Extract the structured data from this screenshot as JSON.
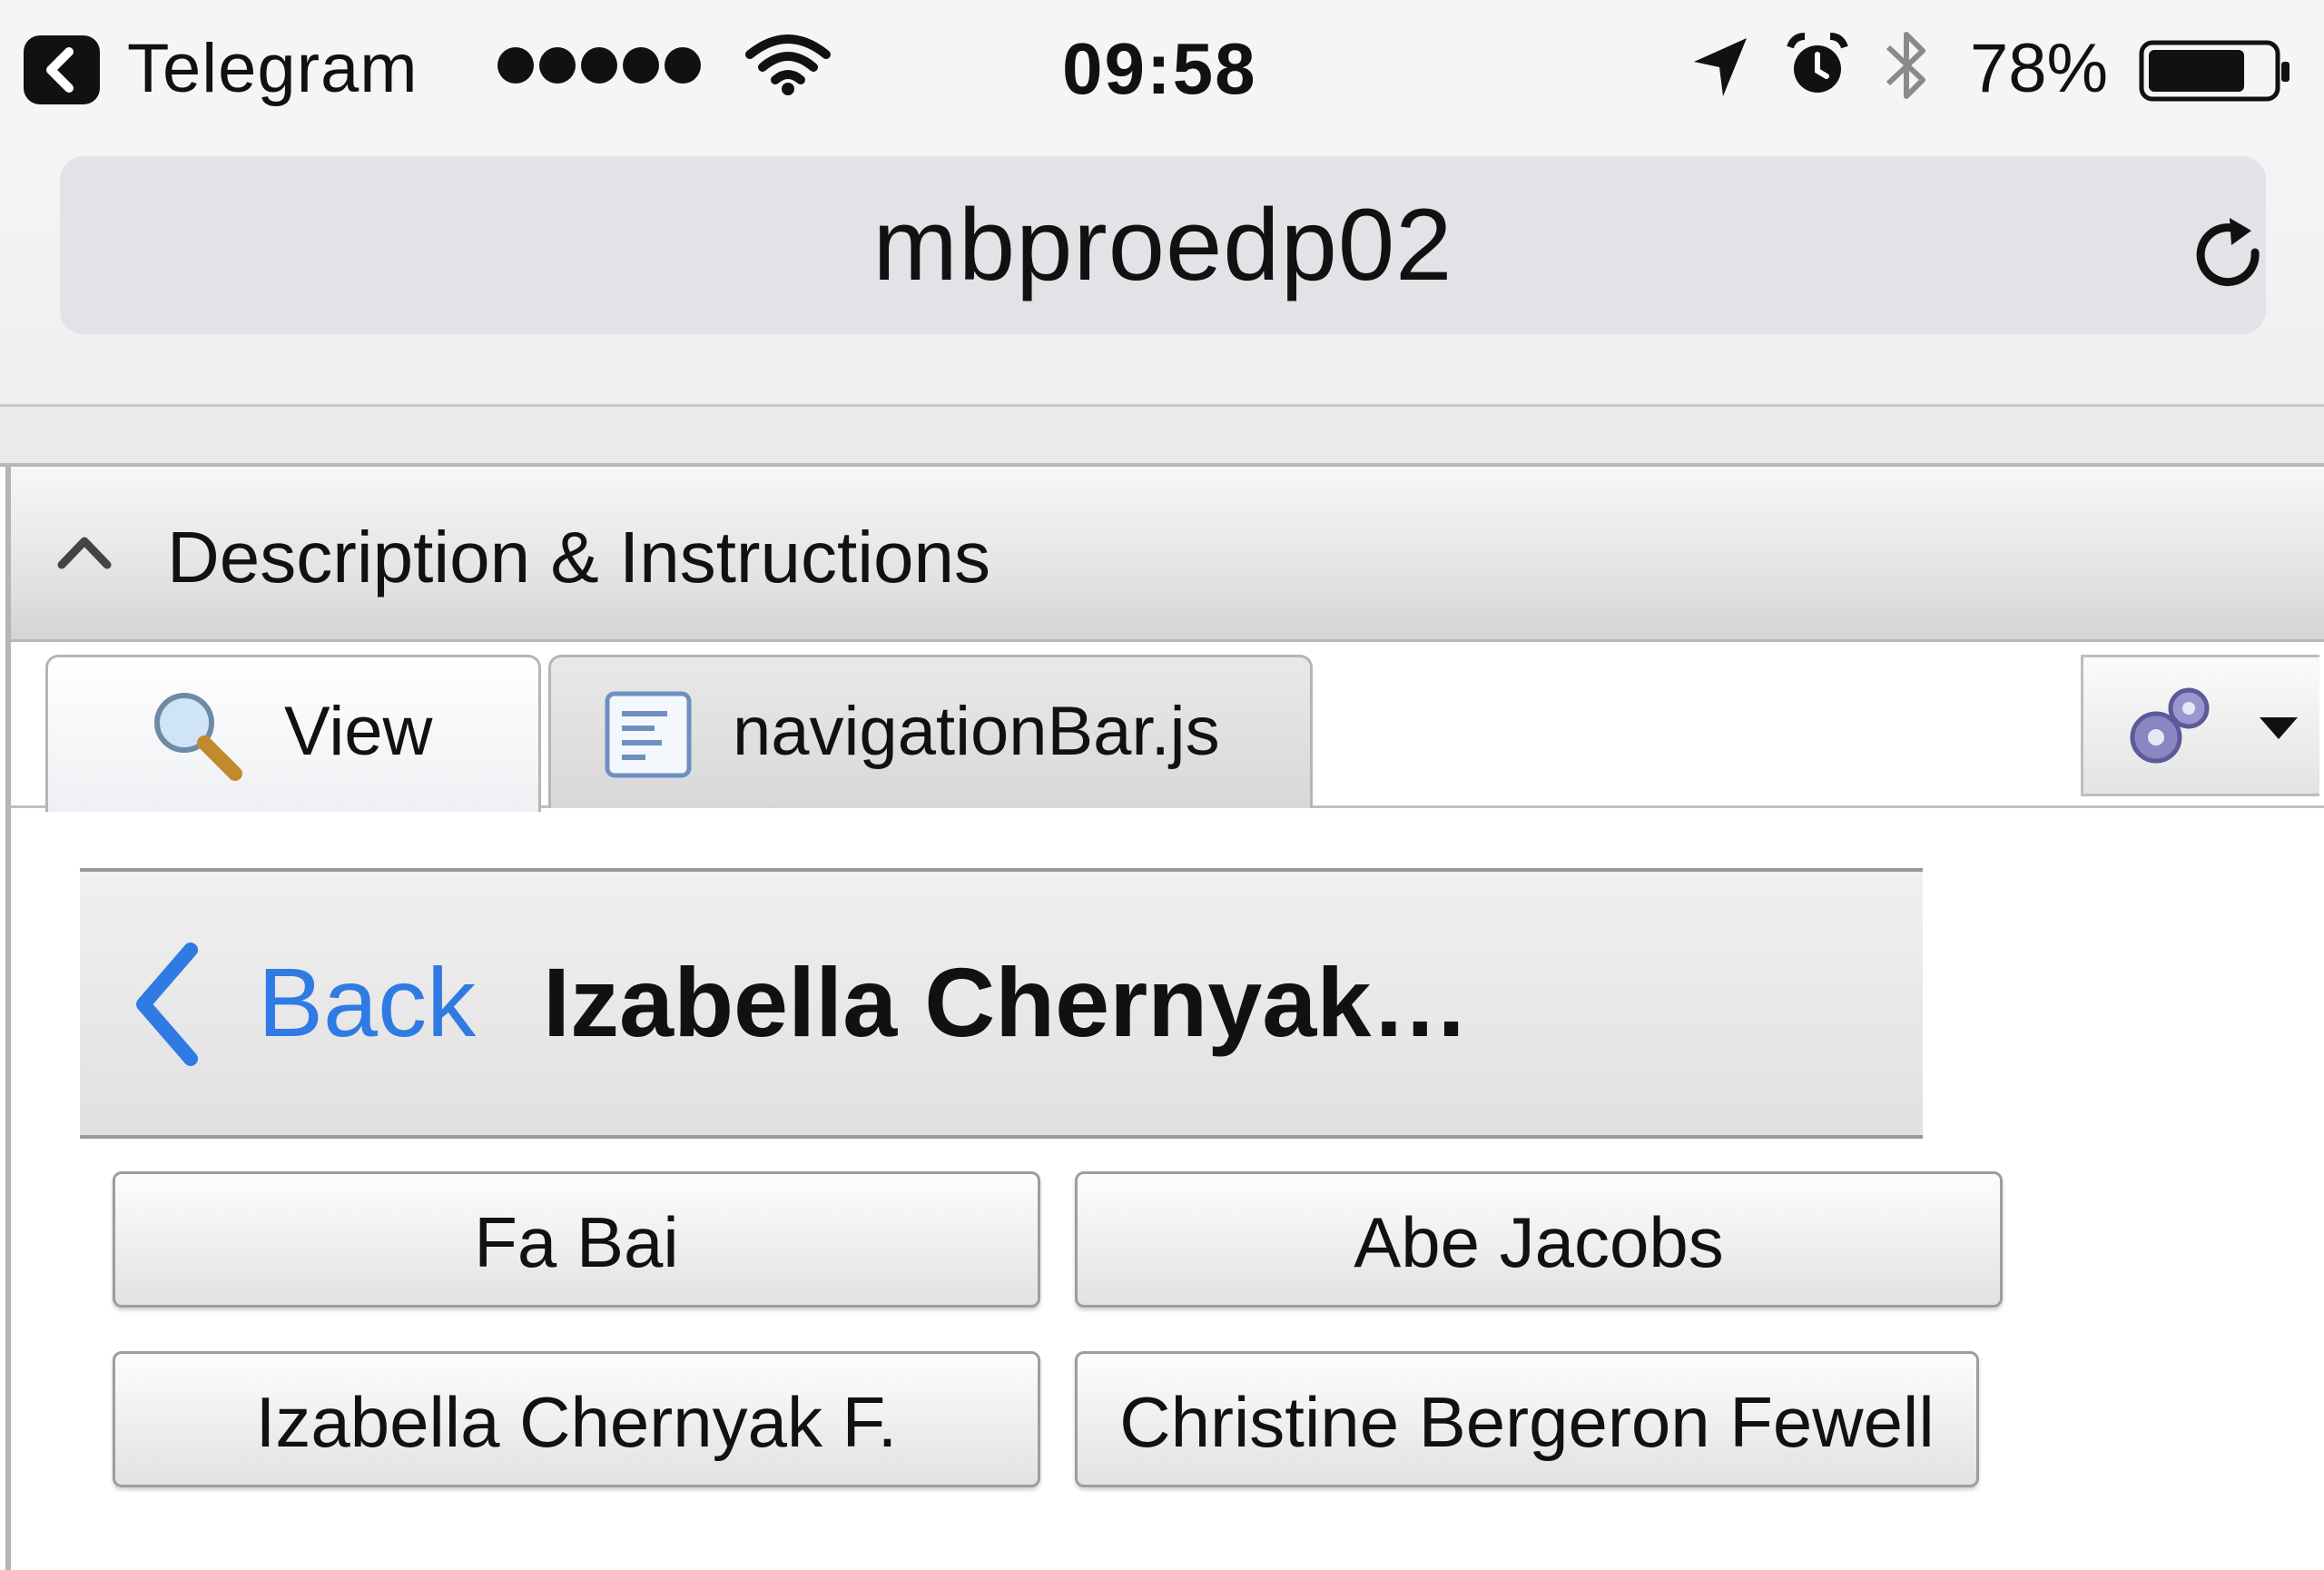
{
  "status_bar": {
    "back_app": "Telegram",
    "time": "09:58",
    "battery_percent": "78%",
    "battery_level": 0.78,
    "signal_bars": 5,
    "icons": [
      "back-to-app-icon",
      "signal-dots-icon",
      "wifi-icon",
      "location-arrow-icon",
      "alarm-icon",
      "bluetooth-icon",
      "battery-icon"
    ]
  },
  "browser": {
    "url": "mbproedp02",
    "reload_icon": "reload-icon"
  },
  "panel": {
    "header_title": "Description & Instructions",
    "tabs": [
      {
        "label": "View",
        "icon": "magnifier-icon",
        "active": true
      },
      {
        "label": "navigationBar.js",
        "icon": "document-icon",
        "active": false
      }
    ],
    "settings_icon": "gears-icon"
  },
  "app": {
    "navbar": {
      "back_label": "Back",
      "title": "Izabella Chernyak…",
      "back_color": "#2f7be3"
    },
    "contacts": [
      {
        "label": "Fa Bai"
      },
      {
        "label": "Abe Jacobs"
      },
      {
        "label": "Izabella Chernyak F."
      },
      {
        "label": "Christine Bergeron Fewell"
      }
    ]
  }
}
